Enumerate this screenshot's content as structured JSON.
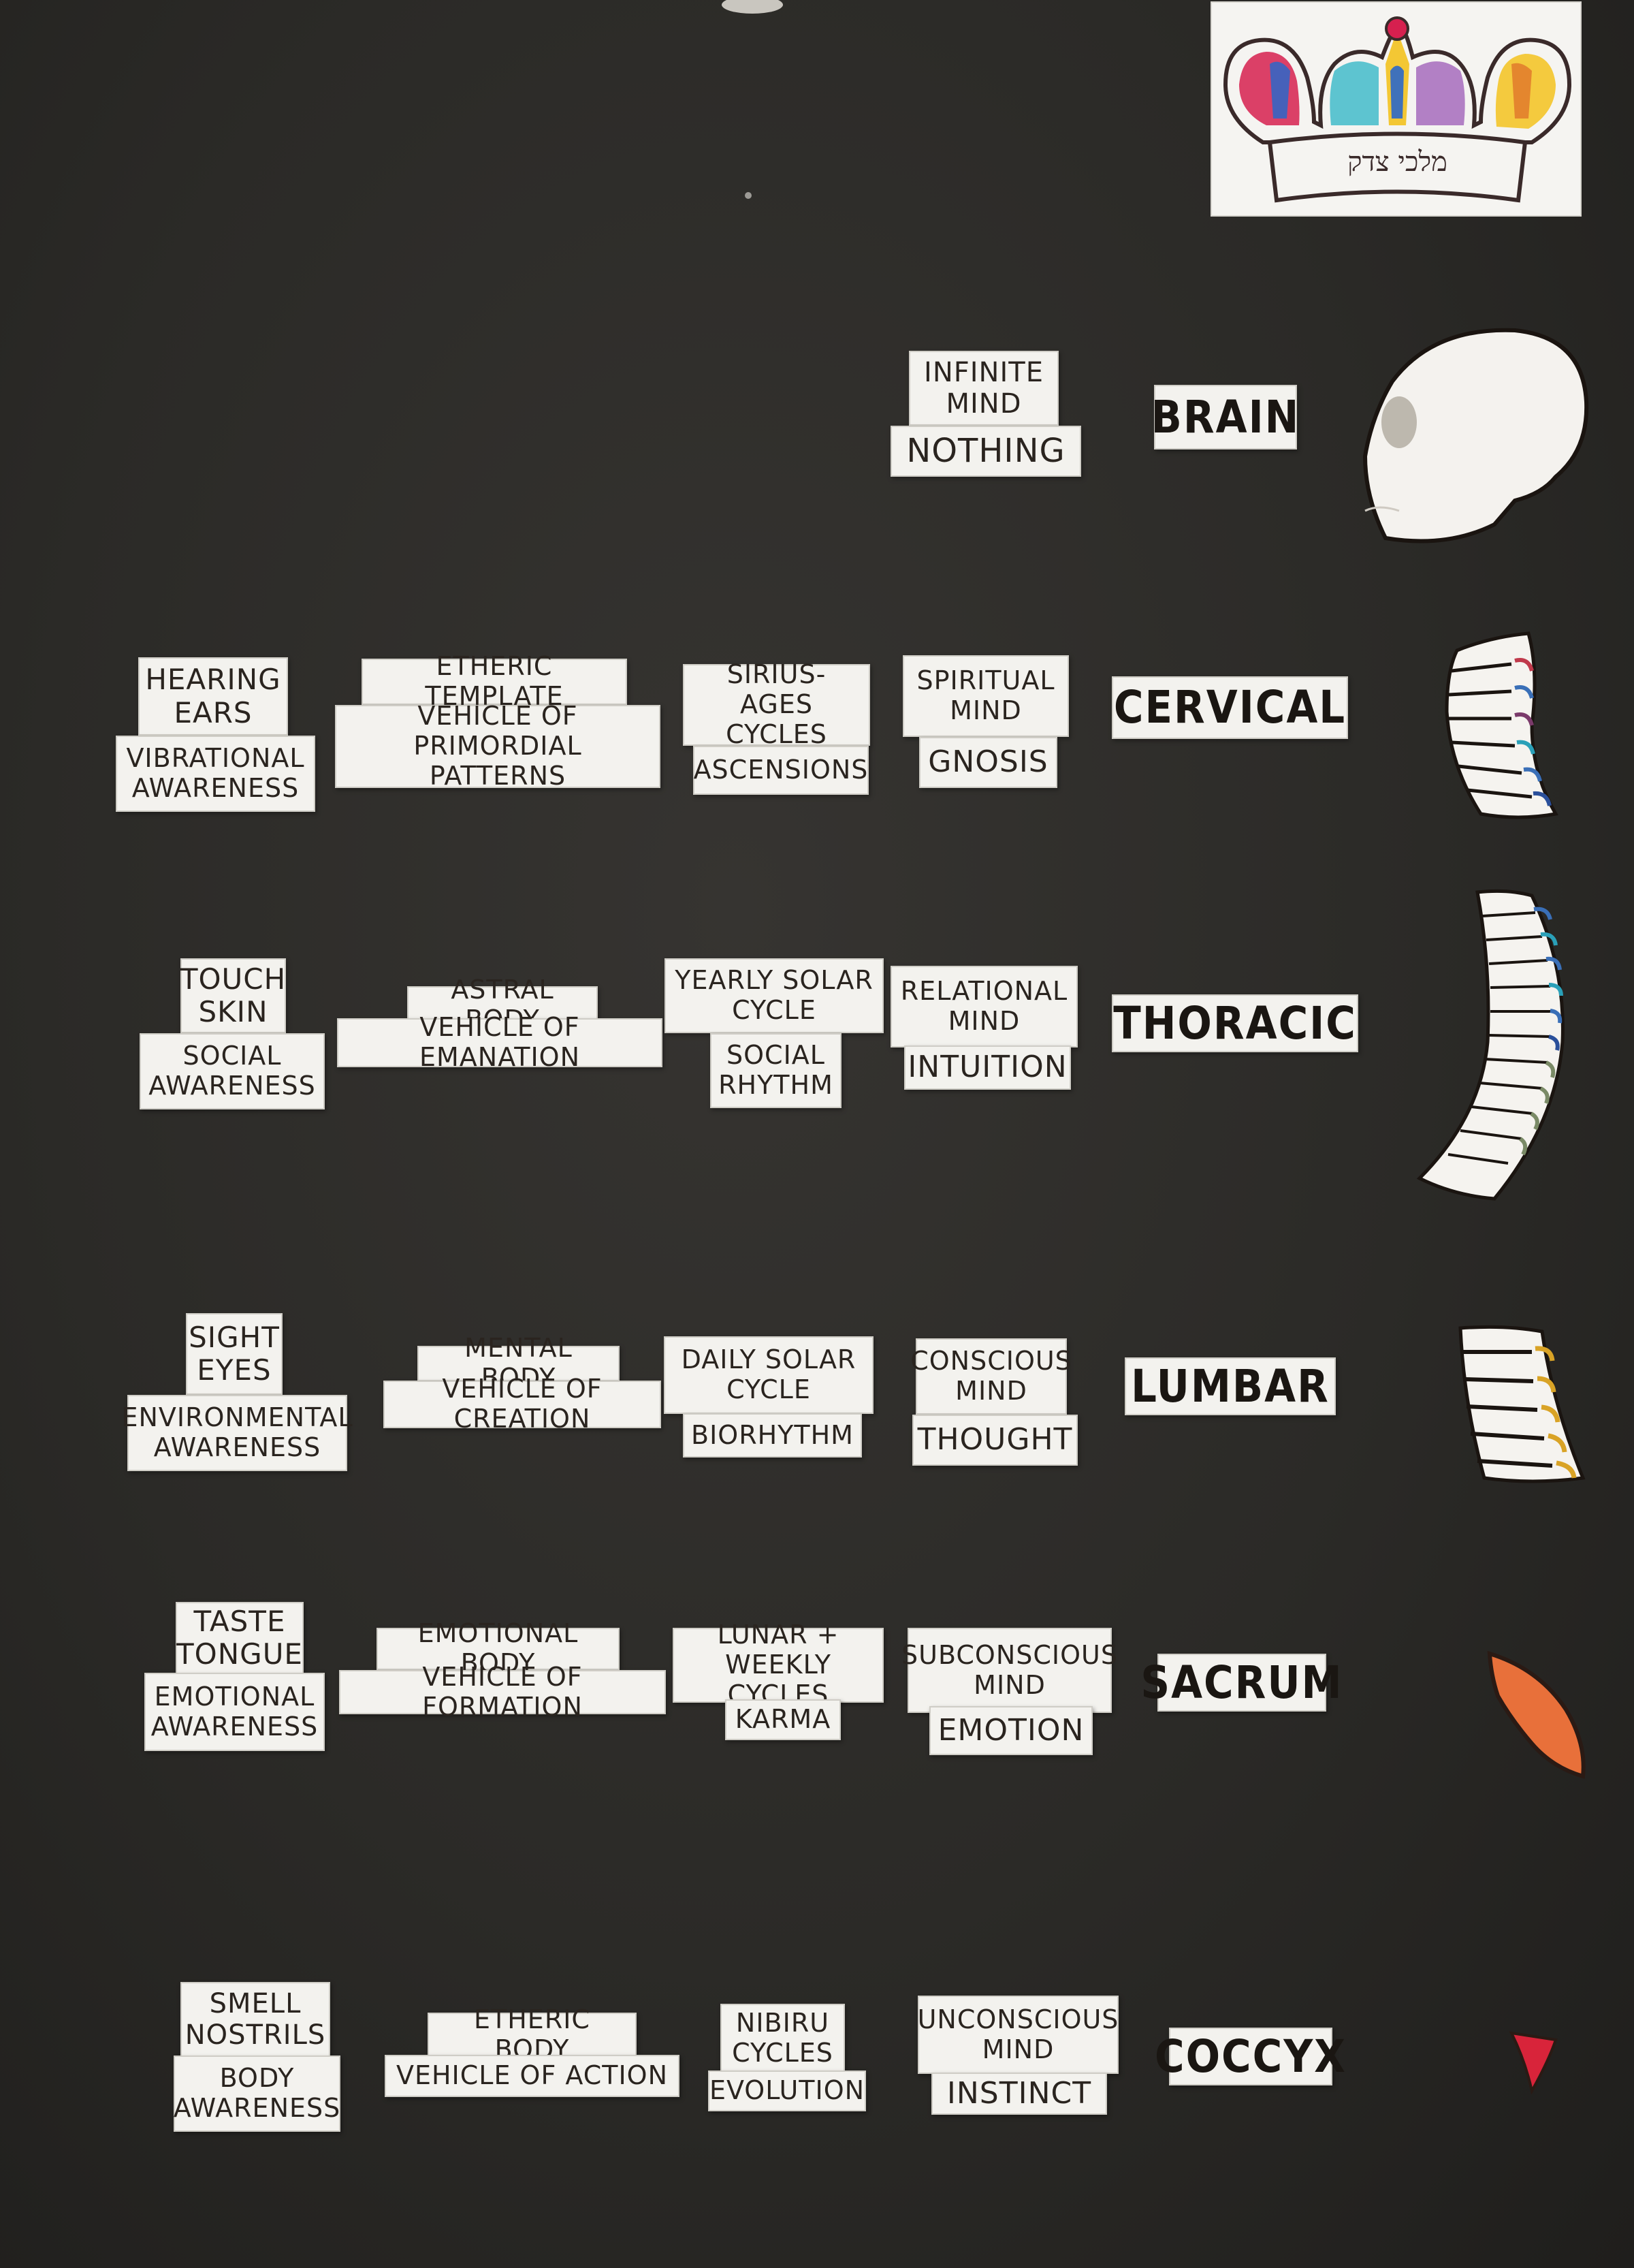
{
  "crown": {
    "card_background": "#f5f4f1",
    "hebrew_text": "מלכי צדק",
    "colors": [
      "#d6204f",
      "#2b67c9",
      "#f3c21f",
      "#37b8c8",
      "#9b59b6",
      "#e07a2c"
    ]
  },
  "rows": [
    {
      "key": "brain",
      "label": "BRAIN",
      "mind": [
        "INFINITE\nMIND",
        "NOTHING"
      ]
    },
    {
      "key": "cervical",
      "label": "CERVICAL",
      "sense": [
        "HEARING\nEARS",
        "VIBRATIONAL\nAWARENESS"
      ],
      "body": [
        "ETHERIC TEMPLATE",
        "VEHICLE OF PRIMORDIAL\nPATTERNS"
      ],
      "cycle": [
        "SIRIUS-AGES\nCYCLES",
        "ASCENSIONS"
      ],
      "mind": [
        "SPIRITUAL\nMIND",
        "GNOSIS"
      ]
    },
    {
      "key": "thoracic",
      "label": "THORACIC",
      "sense": [
        "TOUCH\nSKIN",
        "SOCIAL\nAWARENESS"
      ],
      "body": [
        "ASTRAL BODY",
        "VEHICLE OF EMANATION"
      ],
      "cycle": [
        "YEARLY SOLAR\nCYCLE",
        "SOCIAL\nRHYTHM"
      ],
      "mind": [
        "RELATIONAL\nMIND",
        "INTUITION"
      ]
    },
    {
      "key": "lumbar",
      "label": "LUMBAR",
      "sense": [
        "SIGHT\nEYES",
        "ENVIRONMENTAL\nAWARENESS"
      ],
      "body": [
        "MENTAL BODY",
        "VEHICLE OF CREATION"
      ],
      "cycle": [
        "DAILY SOLAR\nCYCLE",
        "BIORHYTHM"
      ],
      "mind": [
        "CONSCIOUS\nMIND",
        "THOUGHT"
      ]
    },
    {
      "key": "sacrum",
      "label": "SACRUM",
      "sense": [
        "TASTE\nTONGUE",
        "EMOTIONAL\nAWARENESS"
      ],
      "body": [
        "EMOTIONAL BODY",
        "VEHICLE OF FORMATION"
      ],
      "cycle": [
        "LUNAR + WEEKLY\nCYCLES",
        "KARMA"
      ],
      "mind": [
        "SUBCONSCIOUS\nMIND",
        "EMOTION"
      ]
    },
    {
      "key": "coccyx",
      "label": "COCCYX",
      "sense": [
        "SMELL\nNOSTRILS",
        "BODY\nAWARENESS"
      ],
      "body": [
        "ETHERIC BODY",
        "VEHICLE OF ACTION"
      ],
      "cycle": [
        "NIBIRU\nCYCLES",
        "EVOLUTION"
      ],
      "mind": [
        "UNCONSCIOUS\nMIND",
        "INSTINCT"
      ]
    }
  ],
  "illustrations": {
    "skull": "skull-drawing",
    "cervical": "cervical-vertebrae-drawing",
    "thoracic": "thoracic-vertebrae-drawing",
    "lumbar": "lumbar-vertebrae-drawing",
    "sacrum": "sacrum-drawing",
    "coccyx": "coccyx-drawing",
    "vertebra_colors": [
      "#c0394b",
      "#3a6fb7",
      "#2aa0b8",
      "#d9a326",
      "#7a8a66"
    ],
    "sacrum_color": "#e8703a",
    "coccyx_color": "#d8243a"
  }
}
